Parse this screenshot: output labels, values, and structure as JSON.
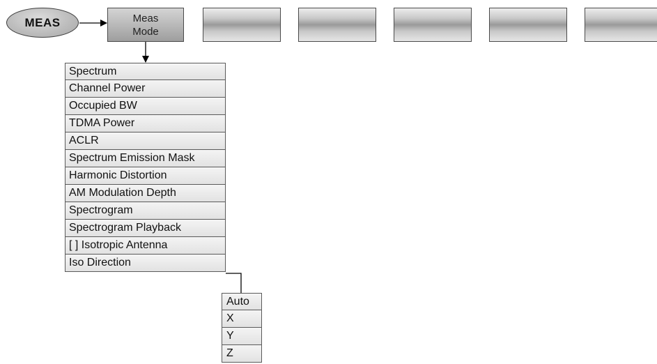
{
  "meas_key": {
    "label": "MEAS"
  },
  "softkeys": [
    {
      "line1": "Meas",
      "line2": "Mode"
    },
    {
      "line1": "",
      "line2": ""
    },
    {
      "line1": "",
      "line2": ""
    },
    {
      "line1": "",
      "line2": ""
    },
    {
      "line1": "",
      "line2": ""
    },
    {
      "line1": "",
      "line2": ""
    }
  ],
  "meas_mode_menu": {
    "items": [
      "Spectrum",
      "Channel Power",
      "Occupied BW",
      "TDMA Power",
      "ACLR",
      "Spectrum Emission Mask",
      "Harmonic Distortion",
      "AM Modulation Depth",
      "Spectrogram",
      "Spectrogram Playback",
      "[ ] Isotropic Antenna",
      "Iso Direction"
    ]
  },
  "iso_direction_menu": {
    "items": [
      "Auto",
      "X",
      "Y",
      "Z"
    ]
  }
}
